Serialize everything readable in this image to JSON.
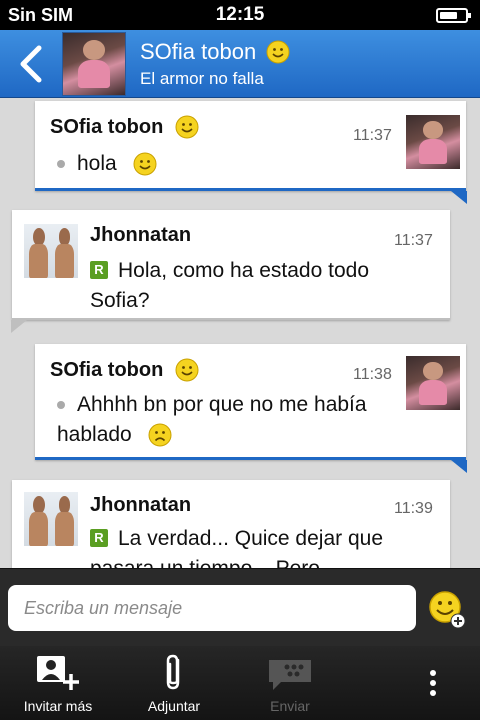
{
  "status_bar": {
    "carrier": "Sin SIM",
    "time": "12:15",
    "battery_level": 0.6
  },
  "header": {
    "contact_name": "SOfia tobon",
    "status_message": "El armor no falla"
  },
  "messages": [
    {
      "sender": "SOfia tobon",
      "time": "11:37",
      "text": "hola",
      "side": "right",
      "emoji": "smiley"
    },
    {
      "sender": "Jhonnatan",
      "time": "11:37",
      "text": "Hola, como ha estado todo Sofia?",
      "side": "left",
      "status": "R"
    },
    {
      "sender": "SOfia tobon",
      "time": "11:38",
      "text": "Ahhhh bn por que no me había hablado",
      "side": "right",
      "emoji": "sad"
    },
    {
      "sender": "Jhonnatan",
      "time": "11:39",
      "text": "La verdad... Quice dejar que pasara un tiempo... Pero",
      "side": "left",
      "status": "R"
    }
  ],
  "composer": {
    "placeholder": "Escriba un mensaje"
  },
  "toolbar": {
    "invite_label": "Invitar más",
    "attach_label": "Adjuntar",
    "send_label": "Enviar"
  },
  "colors": {
    "header_blue": "#1f68c4",
    "accent_bar": "#1f68c4",
    "read_badge": "#5a9e22"
  }
}
